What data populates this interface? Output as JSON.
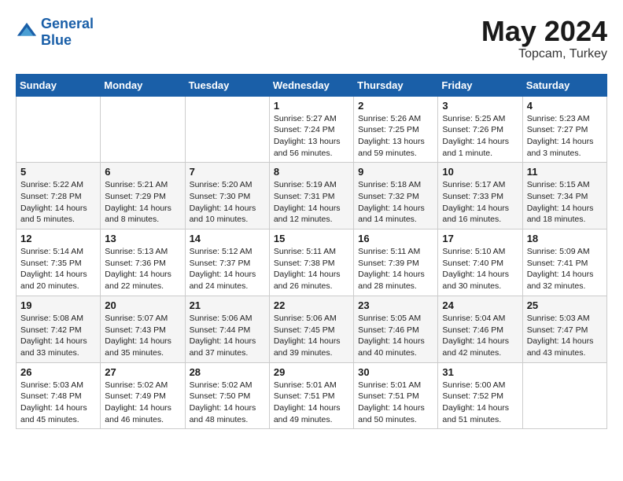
{
  "header": {
    "logo_line1": "General",
    "logo_line2": "Blue",
    "title": "May 2024",
    "subtitle": "Topcam, Turkey"
  },
  "days_of_week": [
    "Sunday",
    "Monday",
    "Tuesday",
    "Wednesday",
    "Thursday",
    "Friday",
    "Saturday"
  ],
  "weeks": [
    [
      {
        "day": "",
        "info": ""
      },
      {
        "day": "",
        "info": ""
      },
      {
        "day": "",
        "info": ""
      },
      {
        "day": "1",
        "info": "Sunrise: 5:27 AM\nSunset: 7:24 PM\nDaylight: 13 hours and 56 minutes."
      },
      {
        "day": "2",
        "info": "Sunrise: 5:26 AM\nSunset: 7:25 PM\nDaylight: 13 hours and 59 minutes."
      },
      {
        "day": "3",
        "info": "Sunrise: 5:25 AM\nSunset: 7:26 PM\nDaylight: 14 hours and 1 minute."
      },
      {
        "day": "4",
        "info": "Sunrise: 5:23 AM\nSunset: 7:27 PM\nDaylight: 14 hours and 3 minutes."
      }
    ],
    [
      {
        "day": "5",
        "info": "Sunrise: 5:22 AM\nSunset: 7:28 PM\nDaylight: 14 hours and 5 minutes."
      },
      {
        "day": "6",
        "info": "Sunrise: 5:21 AM\nSunset: 7:29 PM\nDaylight: 14 hours and 8 minutes."
      },
      {
        "day": "7",
        "info": "Sunrise: 5:20 AM\nSunset: 7:30 PM\nDaylight: 14 hours and 10 minutes."
      },
      {
        "day": "8",
        "info": "Sunrise: 5:19 AM\nSunset: 7:31 PM\nDaylight: 14 hours and 12 minutes."
      },
      {
        "day": "9",
        "info": "Sunrise: 5:18 AM\nSunset: 7:32 PM\nDaylight: 14 hours and 14 minutes."
      },
      {
        "day": "10",
        "info": "Sunrise: 5:17 AM\nSunset: 7:33 PM\nDaylight: 14 hours and 16 minutes."
      },
      {
        "day": "11",
        "info": "Sunrise: 5:15 AM\nSunset: 7:34 PM\nDaylight: 14 hours and 18 minutes."
      }
    ],
    [
      {
        "day": "12",
        "info": "Sunrise: 5:14 AM\nSunset: 7:35 PM\nDaylight: 14 hours and 20 minutes."
      },
      {
        "day": "13",
        "info": "Sunrise: 5:13 AM\nSunset: 7:36 PM\nDaylight: 14 hours and 22 minutes."
      },
      {
        "day": "14",
        "info": "Sunrise: 5:12 AM\nSunset: 7:37 PM\nDaylight: 14 hours and 24 minutes."
      },
      {
        "day": "15",
        "info": "Sunrise: 5:11 AM\nSunset: 7:38 PM\nDaylight: 14 hours and 26 minutes."
      },
      {
        "day": "16",
        "info": "Sunrise: 5:11 AM\nSunset: 7:39 PM\nDaylight: 14 hours and 28 minutes."
      },
      {
        "day": "17",
        "info": "Sunrise: 5:10 AM\nSunset: 7:40 PM\nDaylight: 14 hours and 30 minutes."
      },
      {
        "day": "18",
        "info": "Sunrise: 5:09 AM\nSunset: 7:41 PM\nDaylight: 14 hours and 32 minutes."
      }
    ],
    [
      {
        "day": "19",
        "info": "Sunrise: 5:08 AM\nSunset: 7:42 PM\nDaylight: 14 hours and 33 minutes."
      },
      {
        "day": "20",
        "info": "Sunrise: 5:07 AM\nSunset: 7:43 PM\nDaylight: 14 hours and 35 minutes."
      },
      {
        "day": "21",
        "info": "Sunrise: 5:06 AM\nSunset: 7:44 PM\nDaylight: 14 hours and 37 minutes."
      },
      {
        "day": "22",
        "info": "Sunrise: 5:06 AM\nSunset: 7:45 PM\nDaylight: 14 hours and 39 minutes."
      },
      {
        "day": "23",
        "info": "Sunrise: 5:05 AM\nSunset: 7:46 PM\nDaylight: 14 hours and 40 minutes."
      },
      {
        "day": "24",
        "info": "Sunrise: 5:04 AM\nSunset: 7:46 PM\nDaylight: 14 hours and 42 minutes."
      },
      {
        "day": "25",
        "info": "Sunrise: 5:03 AM\nSunset: 7:47 PM\nDaylight: 14 hours and 43 minutes."
      }
    ],
    [
      {
        "day": "26",
        "info": "Sunrise: 5:03 AM\nSunset: 7:48 PM\nDaylight: 14 hours and 45 minutes."
      },
      {
        "day": "27",
        "info": "Sunrise: 5:02 AM\nSunset: 7:49 PM\nDaylight: 14 hours and 46 minutes."
      },
      {
        "day": "28",
        "info": "Sunrise: 5:02 AM\nSunset: 7:50 PM\nDaylight: 14 hours and 48 minutes."
      },
      {
        "day": "29",
        "info": "Sunrise: 5:01 AM\nSunset: 7:51 PM\nDaylight: 14 hours and 49 minutes."
      },
      {
        "day": "30",
        "info": "Sunrise: 5:01 AM\nSunset: 7:51 PM\nDaylight: 14 hours and 50 minutes."
      },
      {
        "day": "31",
        "info": "Sunrise: 5:00 AM\nSunset: 7:52 PM\nDaylight: 14 hours and 51 minutes."
      },
      {
        "day": "",
        "info": ""
      }
    ]
  ]
}
